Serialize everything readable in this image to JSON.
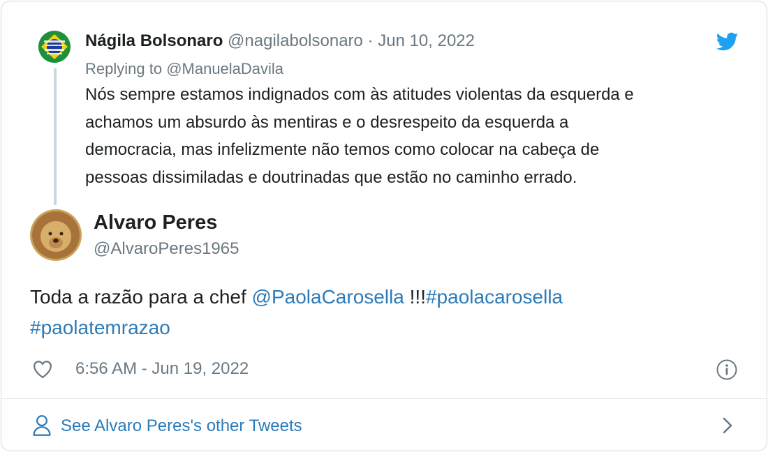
{
  "parent_tweet": {
    "author_name": "Nágila Bolsonaro",
    "author_handle": "@nagilabolsonaro",
    "separator": "·",
    "date": "Jun 10, 2022",
    "reply_prefix": "Replying to ",
    "reply_to_handle": "@ManuelaDavila",
    "text_lines": [
      "Nós sempre estamos indignados com às atitudes violentas da esquerda e",
      "achamos um absurdo às mentiras e o desrespeito da esquerda a",
      "democracia, mas infelizmente não temos como colocar na cabeça de",
      "pessoas dissimiladas e doutrinadas que estão no caminho errado."
    ]
  },
  "main_tweet": {
    "author_name": "Alvaro Peres",
    "author_handle": "@AlvaroPeres1965",
    "text_plain": "Toda a razão para a chef ",
    "mention": "@PaolaCarosella",
    "text_between": " !!!",
    "hashtag_1": "#paolacarosella",
    "hashtag_2": "#paolatemrazao",
    "time": "6:56 AM - Jun 19, 2022"
  },
  "footer": {
    "see_more_label": "See Alvaro Peres's other Tweets"
  },
  "icons": {
    "brand": "twitter-bird-icon",
    "like": "heart-icon",
    "info": "info-icon",
    "profile": "user-icon",
    "chevron": "chevron-right-icon"
  },
  "colors": {
    "link": "#2b7bb9",
    "twitter_blue": "#1da1f2",
    "secondary_text": "#697882",
    "primary_text": "#1c2022"
  }
}
